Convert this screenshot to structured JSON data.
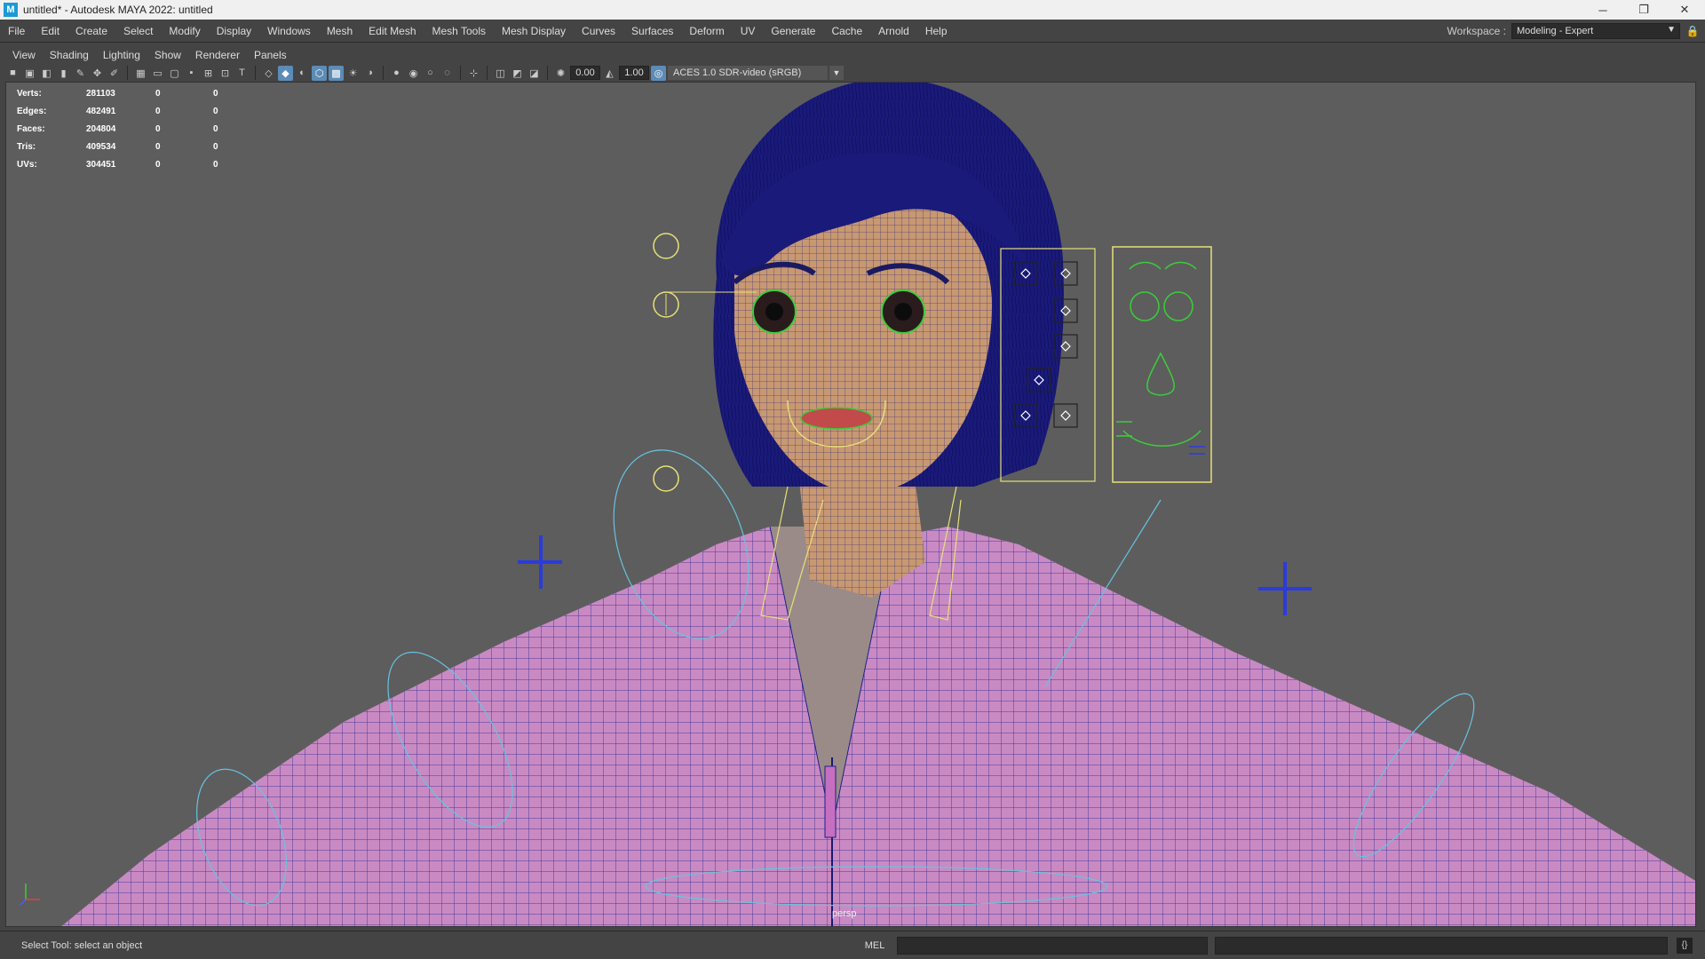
{
  "window": {
    "title": "untitled* - Autodesk MAYA 2022: untitled",
    "logo": "M",
    "controls": {
      "minimize": "─",
      "restore": "❐",
      "close": "✕"
    }
  },
  "menubar": {
    "items": [
      "File",
      "Edit",
      "Create",
      "Select",
      "Modify",
      "Display",
      "Windows",
      "Mesh",
      "Edit Mesh",
      "Mesh Tools",
      "Mesh Display",
      "Curves",
      "Surfaces",
      "Deform",
      "UV",
      "Generate",
      "Cache",
      "Arnold",
      "Help"
    ],
    "workspace_label": "Workspace :",
    "workspace_value": "Modeling - Expert"
  },
  "panel_menu": {
    "items": [
      "View",
      "Shading",
      "Lighting",
      "Show",
      "Renderer",
      "Panels"
    ]
  },
  "panel_toolbar": {
    "exposure": "0.00",
    "gamma": "1.00",
    "color_transform": "ACES 1.0 SDR-video (sRGB)"
  },
  "hud": {
    "rows": [
      {
        "label": "Verts:",
        "value": "281103",
        "a": "0",
        "b": "0"
      },
      {
        "label": "Edges:",
        "value": "482491",
        "a": "0",
        "b": "0"
      },
      {
        "label": "Faces:",
        "value": "204804",
        "a": "0",
        "b": "0"
      },
      {
        "label": "Tris:",
        "value": "409534",
        "a": "0",
        "b": "0"
      },
      {
        "label": "UVs:",
        "value": "304451",
        "a": "0",
        "b": "0"
      }
    ]
  },
  "viewport": {
    "camera": "persp",
    "colors": {
      "background": "#5d5d5d",
      "wire": "#1f1f8c",
      "jacket": "#c98ac3",
      "skin": "#c89872",
      "hair": "#1a1a7a",
      "control_yellow": "#e6e07a",
      "control_green": "#3ccc3c",
      "control_cyan": "#66c3e0"
    }
  },
  "statusbar": {
    "help_text": "Select Tool: select an object",
    "mel_label": "MEL"
  }
}
